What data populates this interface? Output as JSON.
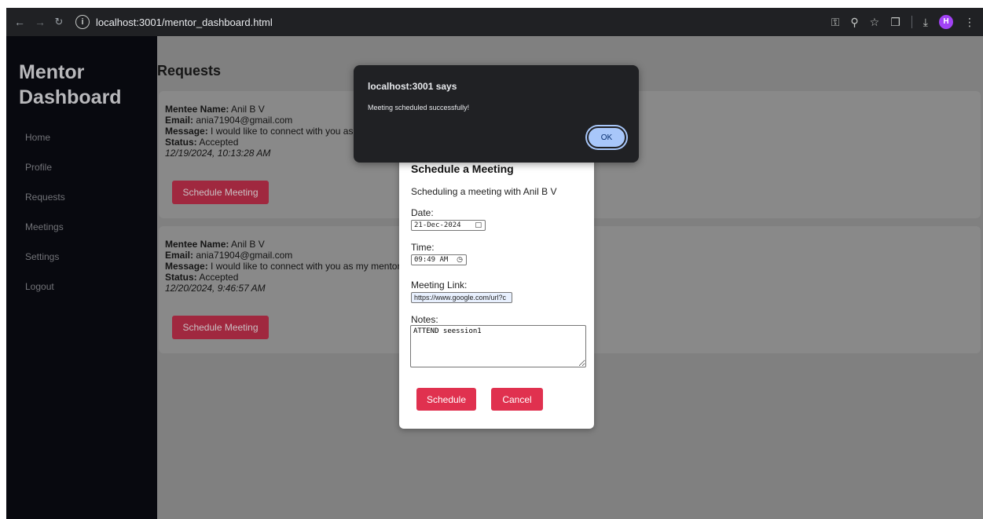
{
  "browser": {
    "url": "localhost:3001/mentor_dashboard.html",
    "profile_initial": "H",
    "icons": [
      "back-icon",
      "forward-icon",
      "reload-icon",
      "site-info-icon",
      "password-key-icon",
      "zoom-icon",
      "bookmark-star-icon",
      "extensions-icon",
      "download-icon",
      "profile-avatar",
      "menu-dots-icon"
    ]
  },
  "sidebar": {
    "title": "Mentor Dashboard",
    "items": [
      {
        "label": "Home"
      },
      {
        "label": "Profile"
      },
      {
        "label": "Requests"
      },
      {
        "label": "Meetings"
      },
      {
        "label": "Settings"
      },
      {
        "label": "Logout"
      }
    ]
  },
  "main": {
    "heading": "Requests",
    "requests": [
      {
        "name_label": "Mentee Name:",
        "name": " Anil B V",
        "email_label": "Email:",
        "email": " ania71904@gmail.com",
        "message_label": "Message:",
        "message": " I would like to connect with you as my mentor.",
        "status_label": "Status:",
        "status": " Accepted",
        "timestamp": "12/19/2024, 10:13:28 AM",
        "button": "Schedule Meeting"
      },
      {
        "name_label": "Mentee Name:",
        "name": " Anil B V",
        "email_label": "Email:",
        "email": " ania71904@gmail.com",
        "message_label": "Message:",
        "message": " I would like to connect with you as my mentor.",
        "status_label": "Status:",
        "status": " Accepted",
        "timestamp": "12/20/2024, 9:46:57 AM",
        "button": "Schedule Meeting"
      }
    ]
  },
  "modal": {
    "title": "Schedule a Meeting",
    "subtitle": "Scheduling a meeting with Anil B V",
    "date_label": "Date:",
    "date_value": "21-Dec-2024",
    "time_label": "Time:",
    "time_value": "09:49 AM",
    "link_label": "Meeting Link:",
    "link_value": "https://www.google.com/url?c",
    "notes_label": "Notes:",
    "notes_value": "ATTEND seession1",
    "schedule_button": "Schedule",
    "cancel_button": "Cancel"
  },
  "alert": {
    "title": "localhost:3001 says",
    "message": "Meeting scheduled successfully!",
    "ok_button": "OK"
  },
  "colors": {
    "sidebar_bg": "#08090f",
    "overlay_bg": "#808080",
    "button_red": "#e0314f",
    "alert_bg": "#202124",
    "ok_blue": "#a8c7fa"
  }
}
